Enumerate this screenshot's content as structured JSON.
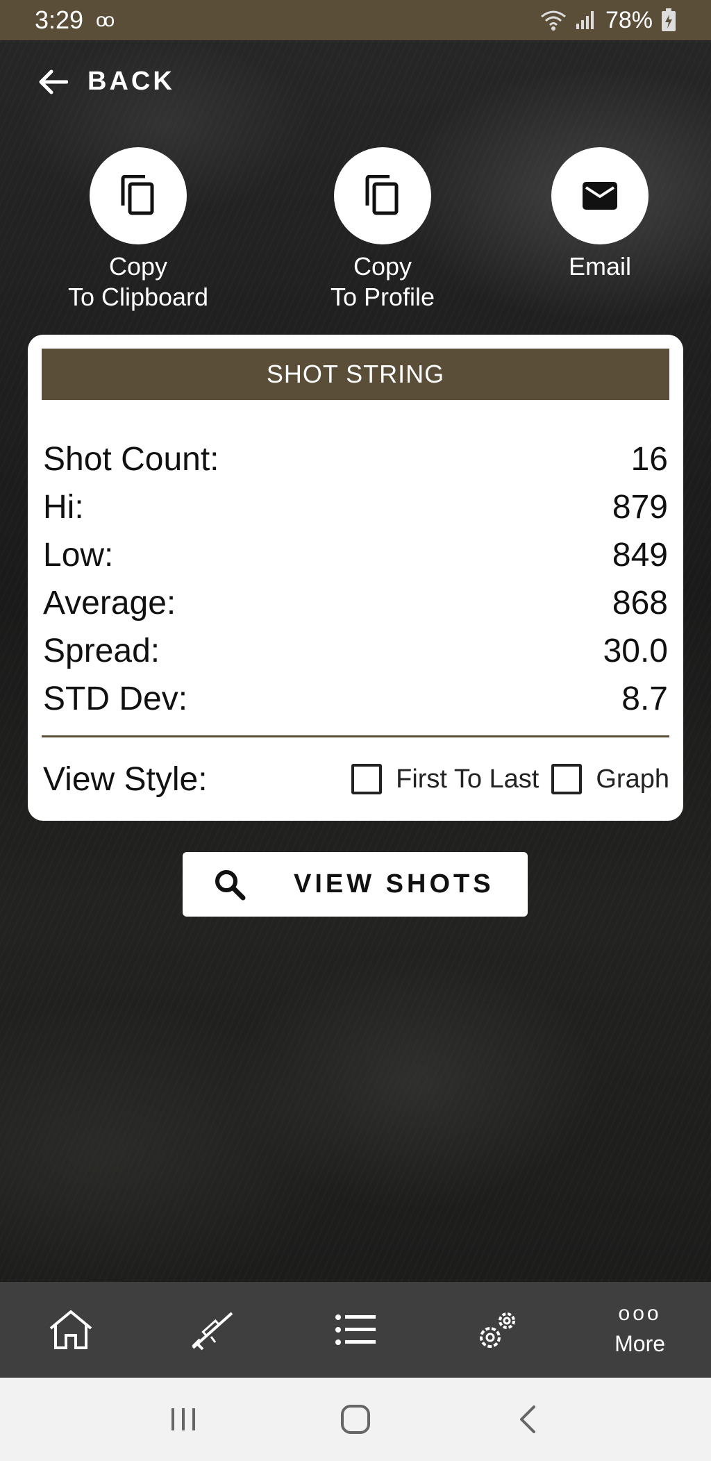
{
  "status_bar": {
    "time": "3:29",
    "voicemail_icon": "oo",
    "battery": "78%"
  },
  "back": {
    "label": "BACK"
  },
  "actions": [
    {
      "label_line1": "Copy",
      "label_line2": "To Clipboard",
      "icon": "copy-icon"
    },
    {
      "label_line1": "Copy",
      "label_line2": "To Profile",
      "icon": "copy-icon"
    },
    {
      "label_line1": "Email",
      "label_line2": "",
      "icon": "email-icon"
    }
  ],
  "card": {
    "title": "SHOT STRING",
    "stats": [
      {
        "label": "Shot Count:",
        "value": "16"
      },
      {
        "label": "Hi:",
        "value": "879"
      },
      {
        "label": "Low:",
        "value": "849"
      },
      {
        "label": "Average:",
        "value": "868"
      },
      {
        "label": "Spread:",
        "value": "30.0"
      },
      {
        "label": "STD Dev:",
        "value": "8.7"
      }
    ],
    "view_style": {
      "label": "View Style:",
      "options": [
        {
          "label": "First To Last",
          "checked": false
        },
        {
          "label": "Graph",
          "checked": false
        }
      ]
    }
  },
  "view_shots": {
    "label": "VIEW SHOTS"
  },
  "bottom_nav": {
    "items": [
      "home-icon",
      "rifle-icon",
      "list-icon",
      "settings-icon"
    ],
    "more_dots": "ooo",
    "more_label": "More"
  },
  "colors": {
    "brand_brown": "#5b4e38",
    "nav_bg": "#3f3f3f"
  }
}
